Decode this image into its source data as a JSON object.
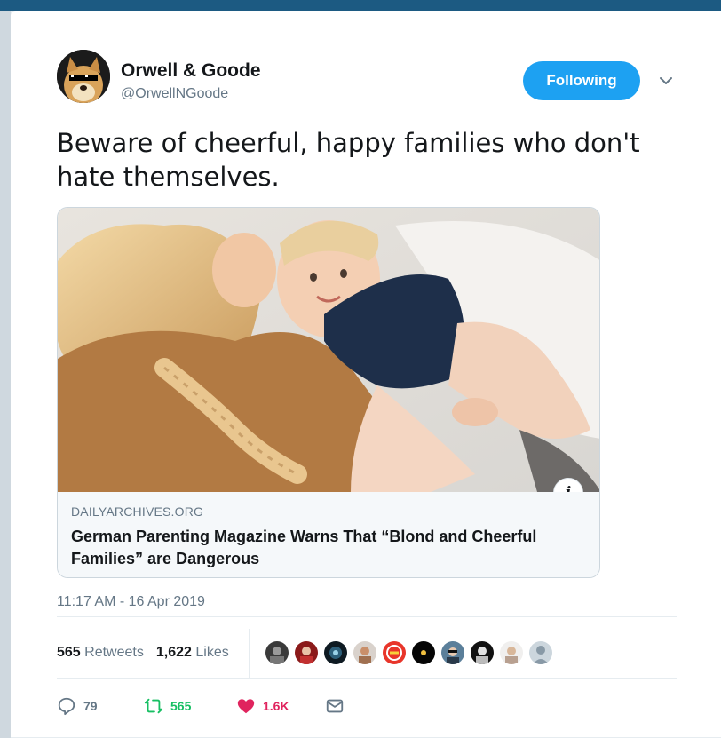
{
  "colors": {
    "accent": "#1da1f2",
    "retweet": "#17bf63",
    "like": "#e0245e",
    "secondary_text": "#657786",
    "primary_text": "#14171a"
  },
  "author": {
    "name": "Orwell & Goode",
    "handle": "@OrwellNGoode",
    "avatar_icon": "doge-with-sunglasses-avatar"
  },
  "follow_button": {
    "label": "Following"
  },
  "menu_caret_icon": "chevron-down-icon",
  "tweet": {
    "text": "Beware of cheerful, happy families who don't hate themselves."
  },
  "card": {
    "image_description_icon": "photo-mother-and-baby",
    "info_icon": "i",
    "domain": "DAILYARCHIVES.ORG",
    "title": "German Parenting Magazine Warns That “Blond and Cheerful Families” are Dangerous"
  },
  "timestamp": "11:17 AM - 16 Apr 2019",
  "stats": {
    "retweets_count": "565",
    "retweets_label": "Retweets",
    "likes_count": "1,622",
    "likes_label": "Likes"
  },
  "liker_avatars_count": 10,
  "actions": {
    "reply_count": "79",
    "retweet_count": "565",
    "like_count": "1.6K"
  }
}
